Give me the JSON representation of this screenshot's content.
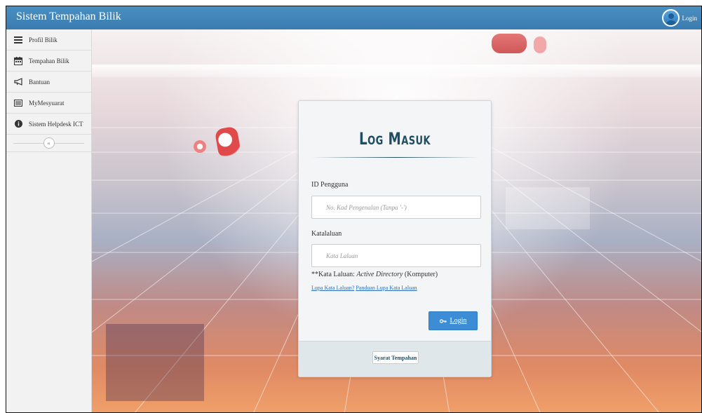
{
  "header": {
    "app_title": "Sistem Tempahan Bilik",
    "login_label": "Login"
  },
  "sidebar": {
    "items": [
      {
        "label": "Profil Bilik",
        "icon": "list-icon"
      },
      {
        "label": "Tempahan Bilik",
        "icon": "calendar-icon"
      },
      {
        "label": "Bantuan",
        "icon": "megaphone-icon"
      },
      {
        "label": "MyMesyuarat",
        "icon": "card-list-icon"
      },
      {
        "label": "Sistem Helpdesk ICT",
        "icon": "info-icon"
      }
    ],
    "collapse_glyph": "«"
  },
  "login_card": {
    "title": "Log Masuk",
    "user_label": "ID Pengguna",
    "user_placeholder": "No. Kad Pengenalan (Tanpa '-')",
    "password_label": "Katalaluan",
    "password_placeholder": "Kata Laluan",
    "hint_prefix": "**Kata Laluan: ",
    "hint_italic": "Active Directory",
    "hint_suffix": " (Komputer)",
    "forgot_link": "Lupa Kata Laluan?",
    "guide_link": "Panduan Lupa Kata Laluan",
    "login_button": "Login",
    "terms_button": "Syarat Tempahan"
  },
  "colors": {
    "topbar": "#3b7cb0",
    "title_text": "#1f4e63",
    "login_button": "#3c8dd5",
    "link": "#2a6ebb"
  }
}
